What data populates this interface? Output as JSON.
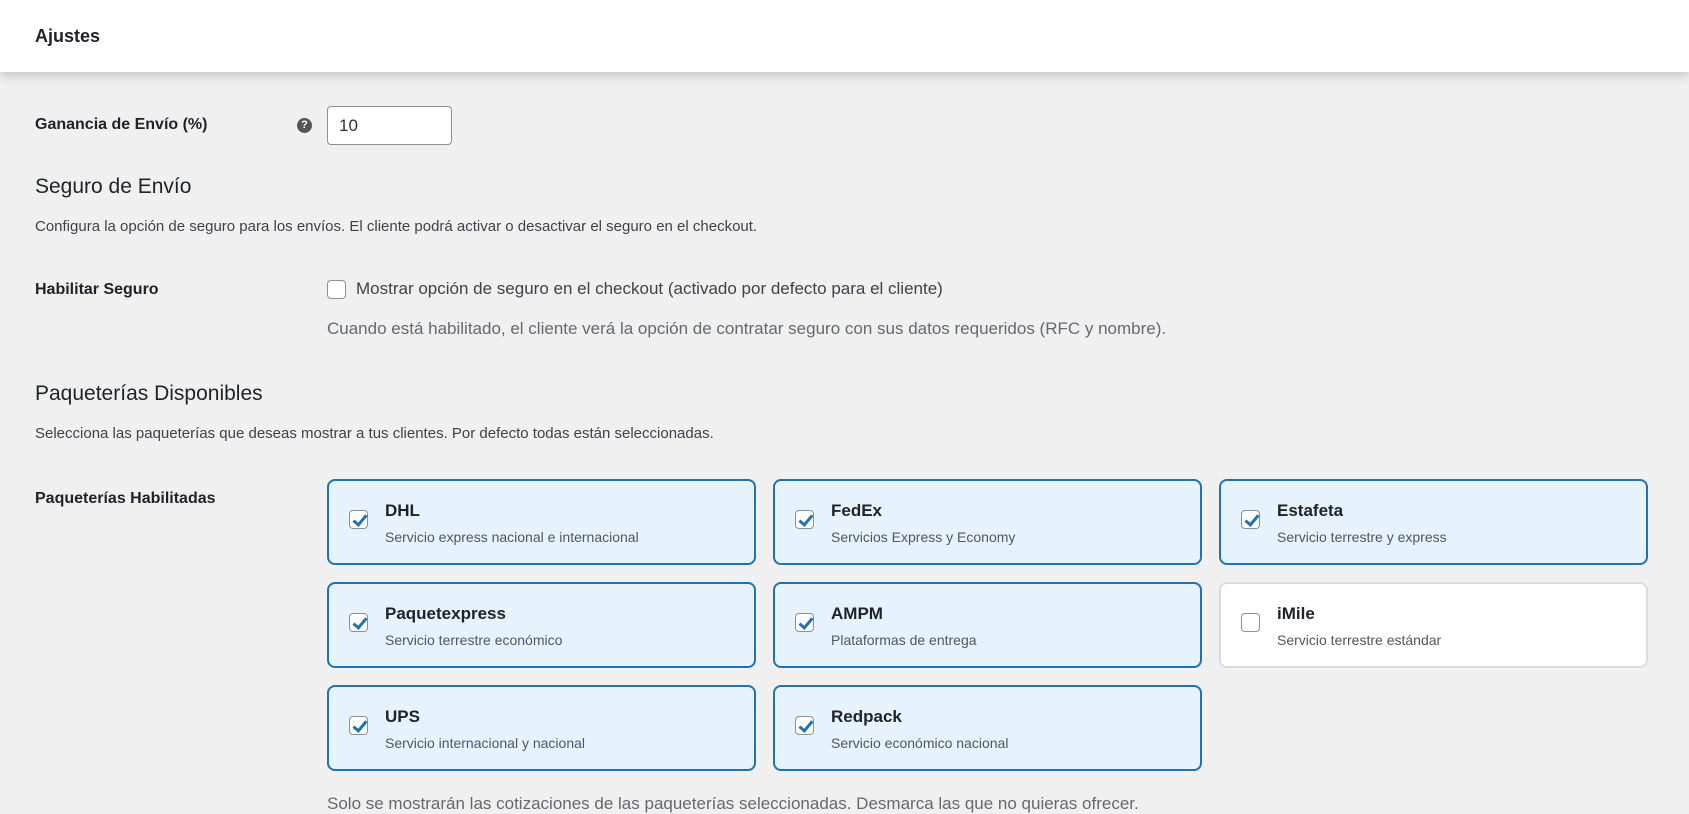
{
  "header": {
    "title": "Ajustes"
  },
  "profit": {
    "label": "Ganancia de Envío (%)",
    "help_icon": "?",
    "value": "10"
  },
  "insurance": {
    "heading": "Seguro de Envío",
    "description": "Configura la opción de seguro para los envíos. El cliente podrá activar o desactivar el seguro en el checkout.",
    "enable_label": "Habilitar Seguro",
    "checkbox_label": "Mostrar opción de seguro en el checkout (activado por defecto para el cliente)",
    "checked": false,
    "note": "Cuando está habilitado, el cliente verá la opción de contratar seguro con sus datos requeridos (RFC y nombre)."
  },
  "carriers": {
    "heading": "Paqueterías Disponibles",
    "description": "Selecciona las paqueterías que deseas mostrar a tus clientes. Por defecto todas están seleccionadas.",
    "enabled_label": "Paqueterías Habilitadas",
    "items": [
      {
        "name": "DHL",
        "desc": "Servicio express nacional e internacional",
        "checked": true
      },
      {
        "name": "FedEx",
        "desc": "Servicios Express y Economy",
        "checked": true
      },
      {
        "name": "Estafeta",
        "desc": "Servicio terrestre y express",
        "checked": true
      },
      {
        "name": "Paquetexpress",
        "desc": "Servicio terrestre económico",
        "checked": true
      },
      {
        "name": "AMPM",
        "desc": "Plataformas de entrega",
        "checked": true
      },
      {
        "name": "iMile",
        "desc": "Servicio terrestre estándar",
        "checked": false
      },
      {
        "name": "UPS",
        "desc": "Servicio internacional y nacional",
        "checked": true
      },
      {
        "name": "Redpack",
        "desc": "Servicio económico nacional",
        "checked": true
      }
    ],
    "footer_note": "Solo se mostrarán las cotizaciones de las paqueterías seleccionadas. Desmarca las que no quieras ofrecer."
  },
  "colors": {
    "accent": "#2271b1",
    "selected_bg": "#e7f3fc",
    "background": "#f0f0f1"
  }
}
